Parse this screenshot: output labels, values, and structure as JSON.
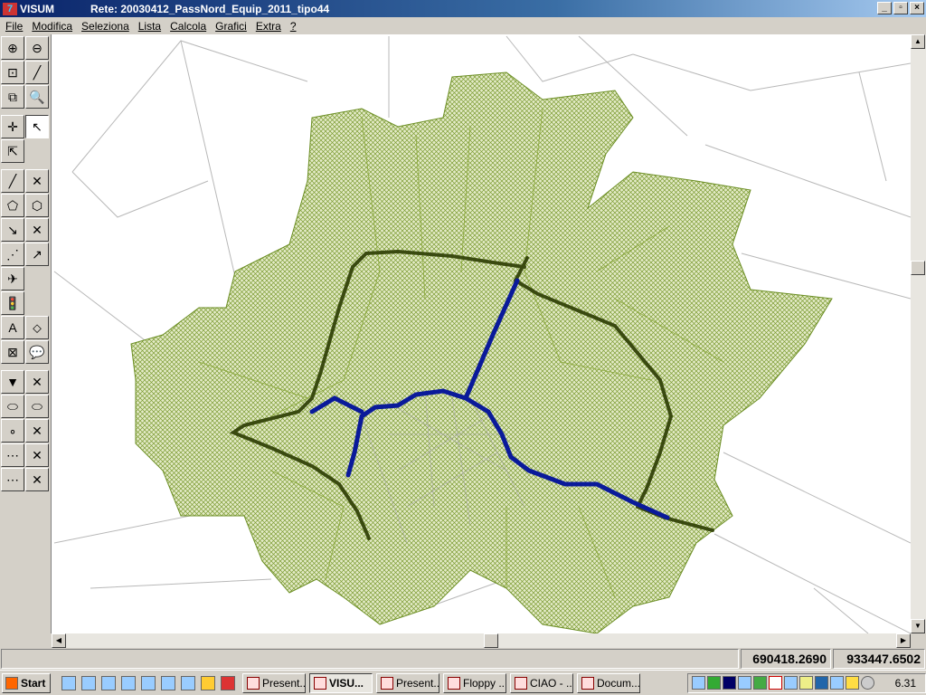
{
  "window": {
    "app": "VISUM",
    "title": "Rete:  20030412_PassNord_Equip_2011_tipo44",
    "controls": [
      "minimize",
      "maximize",
      "close"
    ]
  },
  "menu": [
    "File",
    "Modifica",
    "Seleziona",
    "Lista",
    "Calcola",
    "Grafici",
    "Extra",
    "?"
  ],
  "toolbar": [
    "zoom-in",
    "zoom-out",
    "zoom-window",
    "measure",
    "zoom-all",
    "zoom-preview",
    "pan",
    "select",
    "multi-select",
    "link",
    "link-delete",
    "zone",
    "zone-edit",
    "node-connect",
    "node-delete",
    "polyline",
    "line-route",
    "turn",
    "signal",
    "text",
    "label",
    "screenline",
    "comment",
    "marker-red",
    "marker-delete",
    "zone-pink",
    "zone-pink-edit",
    "point",
    "point-delete",
    "route-points",
    "route-delete",
    "connector",
    "connector-edit"
  ],
  "map": {
    "colors": {
      "zone_fill": "#6b8e23",
      "ring_road": "#3a4a10",
      "blue_road": "#0a1a9a",
      "gray_lines": "#b0b0b0"
    }
  },
  "status": {
    "message": "",
    "x": "690418.2690",
    "y": "933447.6502"
  },
  "taskbar": {
    "start": "Start",
    "tasks": [
      {
        "label": "Present...",
        "active": false
      },
      {
        "label": "VISU...",
        "active": true
      },
      {
        "label": "Present...",
        "active": false
      },
      {
        "label": "Floppy ...",
        "active": false
      },
      {
        "label": "CIAO - ...",
        "active": false
      },
      {
        "label": "Docum...",
        "active": false
      }
    ],
    "clock": "6.31"
  }
}
